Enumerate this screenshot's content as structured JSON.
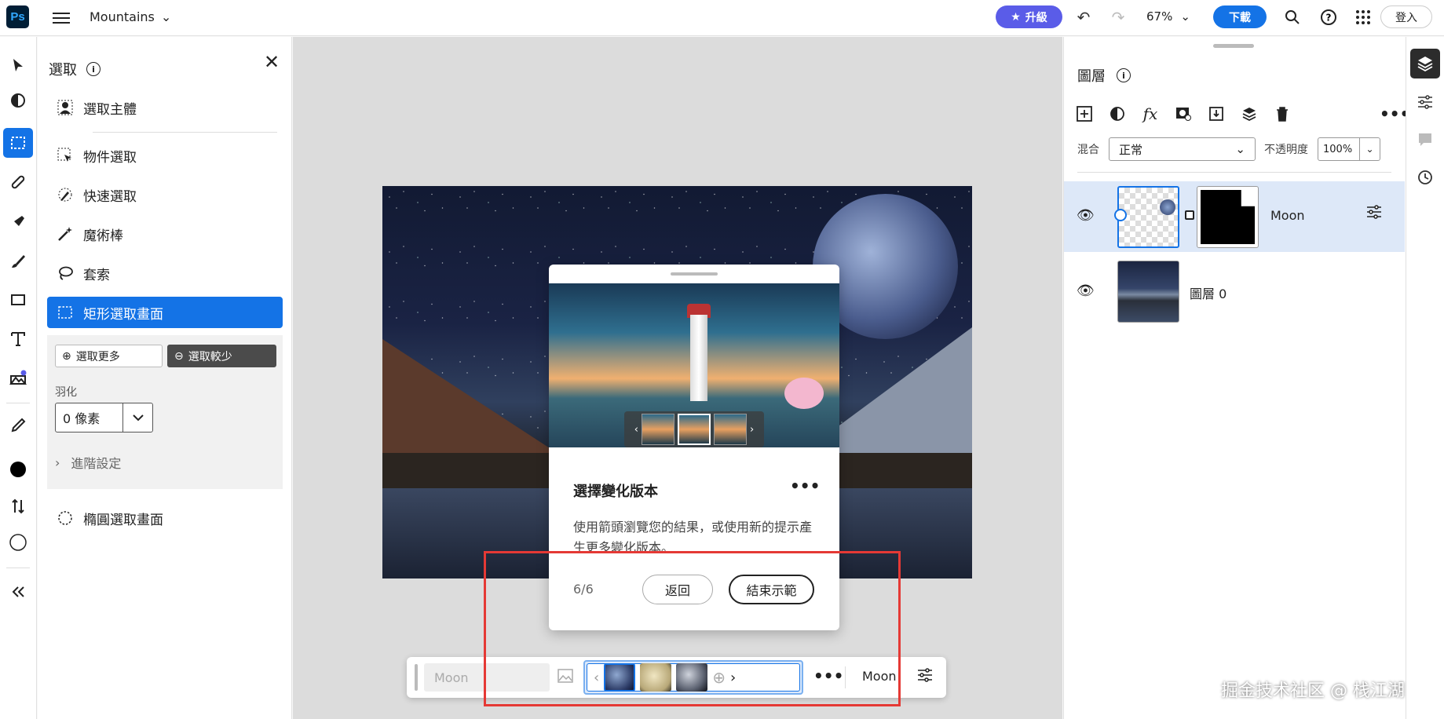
{
  "topbar": {
    "app_logo": "Ps",
    "doc_title": "Mountains",
    "upgrade_label": "升級",
    "zoom": "67%",
    "download_label": "下載",
    "signin_label": "登入"
  },
  "selection_panel": {
    "title": "選取",
    "items": [
      {
        "label": "選取主體"
      },
      {
        "label": "物件選取"
      },
      {
        "label": "快速選取"
      },
      {
        "label": "魔術棒"
      },
      {
        "label": "套索"
      },
      {
        "label": "矩形選取畫面"
      },
      {
        "label": "橢圓選取畫面"
      }
    ],
    "add_label": "選取更多",
    "subtract_label": "選取較少",
    "feather_label": "羽化",
    "feather_value": "0 像素",
    "advanced_label": "進階設定"
  },
  "tour": {
    "title": "選擇變化版本",
    "body": "使用箭頭瀏覽您的結果，或使用新的提示產生更多變化版本。",
    "step": "6/6",
    "back_label": "返回",
    "end_label": "結束示範"
  },
  "context_bar": {
    "prompt_placeholder": "Moon",
    "layer_name": "Moon"
  },
  "layers_panel": {
    "title": "圖層",
    "blend_label": "混合",
    "blend_value": "正常",
    "opacity_label": "不透明度",
    "opacity_value": "100%",
    "layers": [
      {
        "name": "Moon"
      },
      {
        "name": "圖層 0"
      }
    ]
  },
  "watermark": "掘金技术社区 @ 栈江湖",
  "colors": {
    "accent": "#1473e6",
    "upgrade": "#5a5ce8",
    "highlight_box": "#e53935"
  }
}
